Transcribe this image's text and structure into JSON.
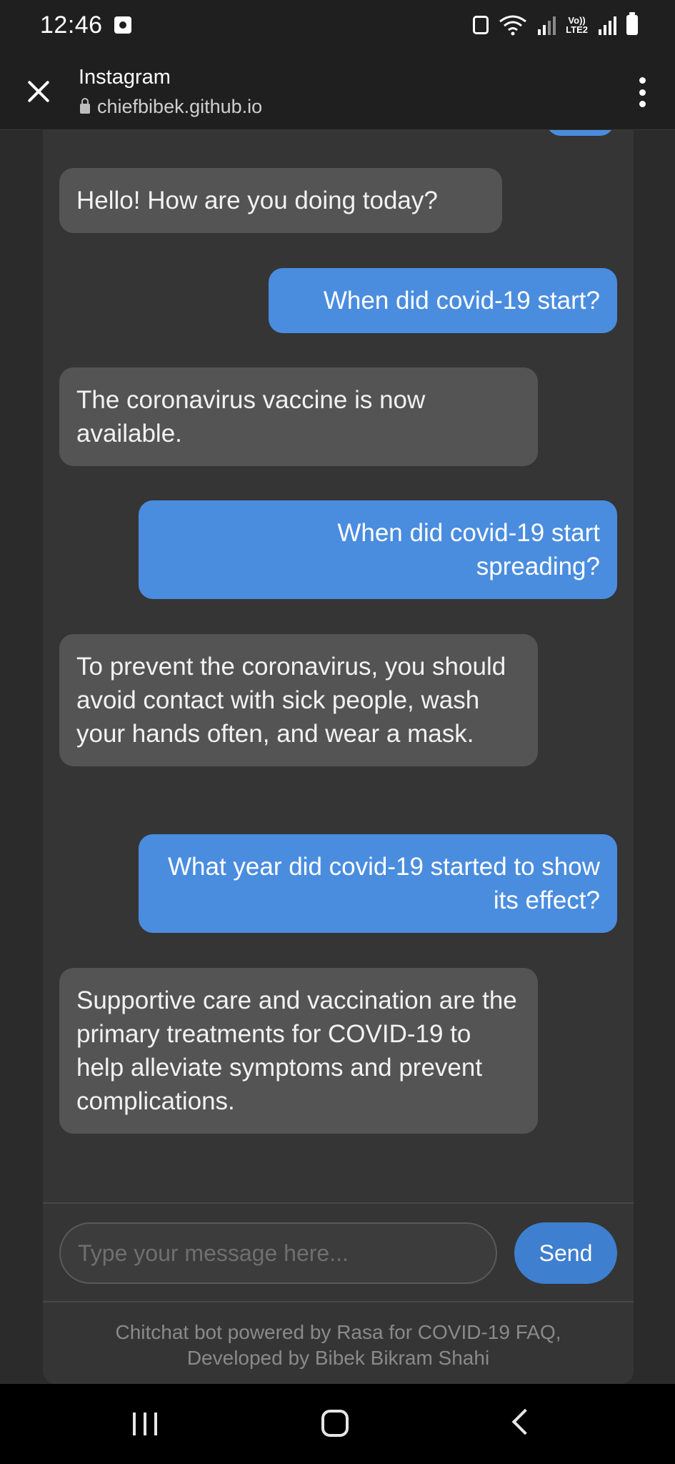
{
  "status_bar": {
    "time": "12:46",
    "lte_label": "Vo))\nLTE2"
  },
  "browser": {
    "title": "Instagram",
    "url": "chiefbibek.github.io"
  },
  "chat": {
    "messages": [
      {
        "sender": "bot",
        "text": "Hello! How are you doing today?"
      },
      {
        "sender": "user",
        "text": "When did covid-19 start?"
      },
      {
        "sender": "bot",
        "text": "The coronavirus vaccine is now available."
      },
      {
        "sender": "user",
        "text": "When did covid-19 start spreading?"
      },
      {
        "sender": "bot",
        "text": "To prevent the coronavirus, you should avoid contact with sick people, wash your hands often, and wear a mask."
      },
      {
        "sender": "user",
        "text": "What year did covid-19 started to show its effect?"
      },
      {
        "sender": "bot",
        "text": "Supportive care and vaccination are the primary treatments for COVID-19 to help alleviate symptoms and prevent complications."
      }
    ],
    "input_placeholder": "Type your message here...",
    "send_label": "Send",
    "footer_line1": "Chitchat bot powered by Rasa for COVID-19 FAQ,",
    "footer_line2": "Developed by Bibek Bikram Shahi"
  },
  "colors": {
    "user_bubble": "#4a8ddf",
    "bot_bubble": "#545454",
    "send_button": "#3f7fcf"
  }
}
